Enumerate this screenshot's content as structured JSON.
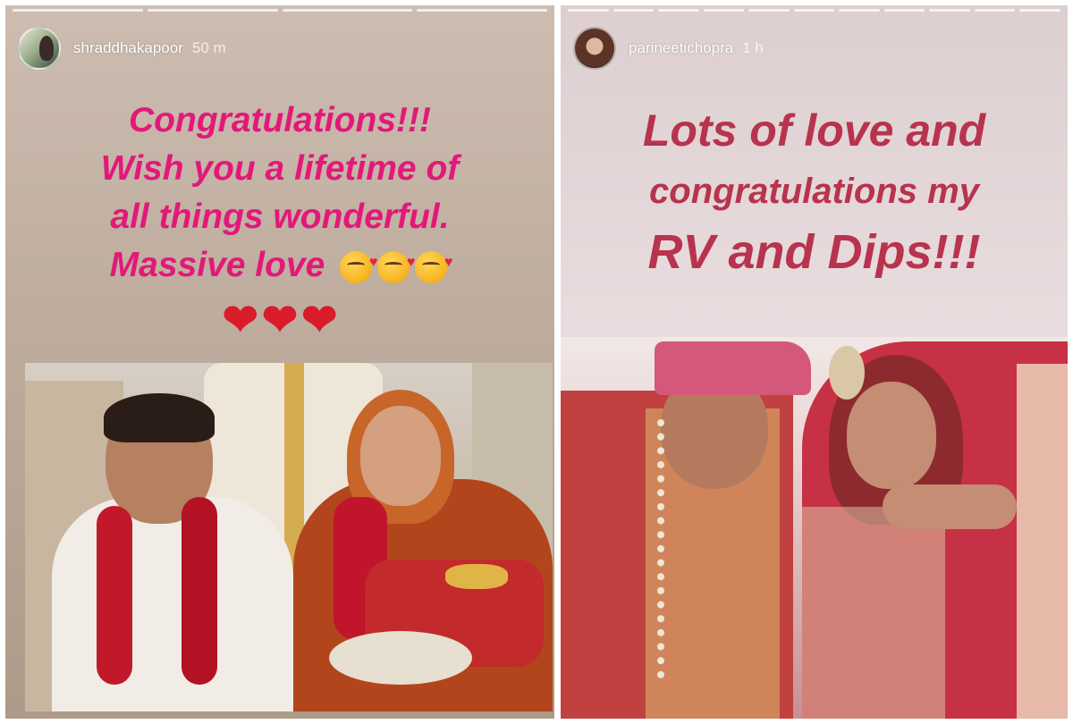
{
  "stories": [
    {
      "username": "shraddhakapoor",
      "time": "50 m",
      "caption_lines": [
        "Congratulations!!!",
        "Wish you a lifetime of",
        "all things wonderful."
      ],
      "caption_last": "Massive love",
      "emoji": [
        "kissing-face-with-heart",
        "kissing-face-with-heart",
        "kissing-face-with-heart",
        "red-heart",
        "red-heart",
        "red-heart"
      ],
      "caption_color": "#e3187a",
      "progress_segments": 4
    },
    {
      "username": "parineetichopra",
      "time": "1 h",
      "caption_lines": [
        "Lots of love and",
        "congratulations my",
        "RV and Dips!!!"
      ],
      "caption_color": "#b8334d",
      "progress_segments": 11
    }
  ]
}
